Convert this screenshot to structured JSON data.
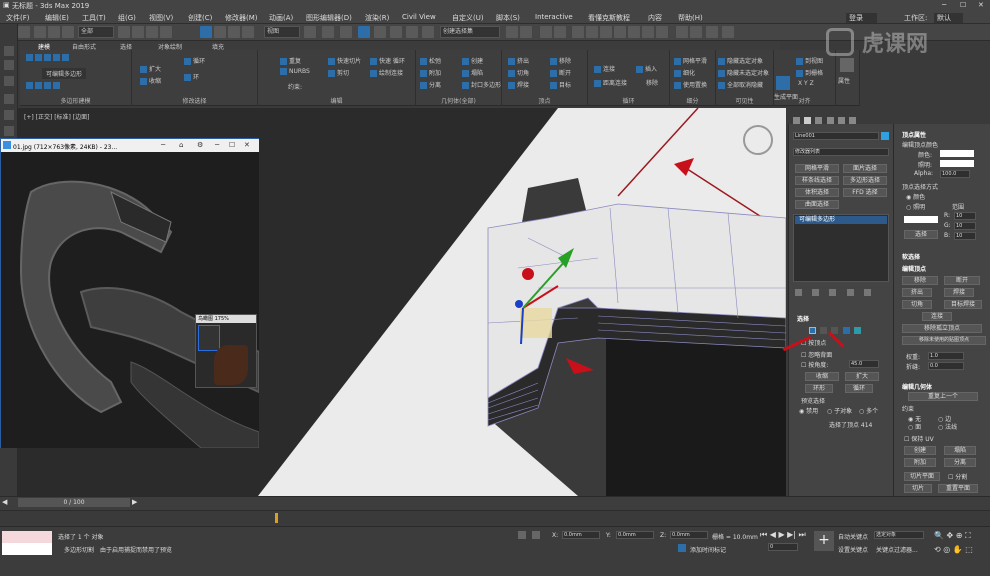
{
  "window": {
    "title": "无标题 - 3ds Max 2019",
    "workspace_label": "工作区:",
    "workspace_value": "默认"
  },
  "watermark": "虎课网",
  "menu": [
    "文件(F)",
    "编辑(E)",
    "工具(T)",
    "组(G)",
    "视图(V)",
    "创建(C)",
    "修改器(M)",
    "动画(A)",
    "图形编辑器(D)",
    "渲染(R)",
    "Civil View",
    "自定义(U)",
    "脚本(S)",
    "Interactive",
    "看懂克斯教程",
    "内容",
    "帮助(H)"
  ],
  "user": "登录",
  "toolbar": {
    "filter": "全部",
    "view": "视图",
    "selection_set": "创建选择集"
  },
  "ribbon_tabs": [
    "建模",
    "自由形式",
    "选择",
    "对象绘制",
    "填充"
  ],
  "ribbon_groups": {
    "polymodel": {
      "label": "多边形建模",
      "btn": "可编辑多边形"
    },
    "modsel": {
      "label": "修改选择",
      "items": [
        "扩大",
        "收缩",
        "循环",
        "环"
      ]
    },
    "edit": {
      "label": "编辑",
      "items": [
        "重复",
        "快速切片",
        "快速 循环",
        "NURBS",
        "剪切",
        "绘制连接",
        "约束:"
      ]
    },
    "geom": {
      "label": "几何体(全部)",
      "items": [
        "松弛",
        "创建",
        "附加",
        "塌陷",
        "分离",
        "封口多边形"
      ]
    },
    "vertices": {
      "label": "顶点",
      "items": [
        "挤出",
        "移除",
        "切角",
        "断开",
        "焊接",
        "目标"
      ]
    },
    "loops": {
      "label": "循环",
      "items": [
        "连接",
        "插入",
        "距离连接",
        "移除"
      ]
    },
    "subdiv": {
      "label": "细分",
      "items": [
        "网格平滑",
        "细化",
        "使用置换"
      ]
    },
    "visibility": {
      "label": "可见性",
      "items": [
        "隐藏选定对象",
        "隐藏未选定对象",
        "全部取消隐藏"
      ]
    },
    "align": {
      "label": "对齐",
      "items": [
        "生成平面",
        "到视图",
        "到栅格"
      ]
    },
    "props": {
      "label": "属性"
    }
  },
  "viewport": {
    "label": "[+] [正交] [标准] [边面]"
  },
  "reference_window": {
    "title": "01.jpg (712×763像素, 24KB) - 23...",
    "navigator_title": "鸟瞰图 175%"
  },
  "command_panel": {
    "object_name": "Line001",
    "modifier_list": "修改器列表",
    "buttons": [
      "网格平滑",
      "面片选择",
      "样条线选择",
      "多边形选择",
      "体积选择",
      "FFD 选择",
      "曲面选择"
    ],
    "stack_item": "可编辑多边形",
    "selection": {
      "header": "选择",
      "by_vertex": "按顶点",
      "ignore_backface": "忽略背面",
      "by_angle": "按角度:",
      "angle_value": "45.0",
      "shrink": "收缩",
      "grow": "扩大",
      "ring": "环形",
      "loop": "循环",
      "preview_header": "预览选择",
      "preview_off": "禁用",
      "preview_sub": "子对象",
      "preview_multi": "多个",
      "status": "选择了顶点 414"
    }
  },
  "right_panel": {
    "vertex_props": "顶点属性",
    "edit_vertex_color": "编辑顶点颜色",
    "color": "颜色:",
    "illum": "照明:",
    "alpha": "Alpha:",
    "alpha_value": "100.0",
    "select_by": "顶点选择方式",
    "by_color": "颜色",
    "by_illum": "照明",
    "range": "范围",
    "r": "R:",
    "g": "G:",
    "b": "B:",
    "rgb_value": "10",
    "select_btn": "选择",
    "soft_sel": "软选择",
    "edit_vertex": "编辑顶点",
    "remove": "移除",
    "break": "断开",
    "extrude": "挤出",
    "weld": "焊接",
    "chamfer": "切角",
    "target_weld": "目标焊接",
    "connect": "连接",
    "remove_iso": "移除孤立顶点",
    "remove_unused": "移除未使用的贴图顶点",
    "weight": "权重:",
    "weight_value": "1.0",
    "crease": "折缝:",
    "crease_value": "0.0",
    "edit_geom": "编辑几何体",
    "repeat_last": "重复上一个",
    "constraints": "约束",
    "c_none": "无",
    "c_edge": "边",
    "c_face": "面",
    "c_normal": "法线",
    "preserve_uv": "保持 UV",
    "create": "创建",
    "collapse": "塌陷",
    "attach": "附加",
    "detach": "分离",
    "slice_plane": "切片平面",
    "split": "分割",
    "slice": "切片",
    "reset_plane": "重置平面"
  },
  "timeline": {
    "frame": "0 / 100"
  },
  "status": {
    "selected": "选择了 1 个 对象",
    "message": "由于启用捕捉而禁用了预览",
    "cut_label": "多边形切割",
    "x_label": "X:",
    "x_value": "0.0mm",
    "y_label": "Y:",
    "y_value": "0.0mm",
    "z_label": "Z:",
    "z_value": "0.0mm",
    "grid": "栅格 = 10.0mm",
    "add_time_tag": "添加时间标记",
    "auto_key": "自动关键点",
    "set_key": "设置关键点",
    "selected_obj": "选定对象",
    "key_filter": "关键点过滤器...",
    "frame_value": "0"
  }
}
